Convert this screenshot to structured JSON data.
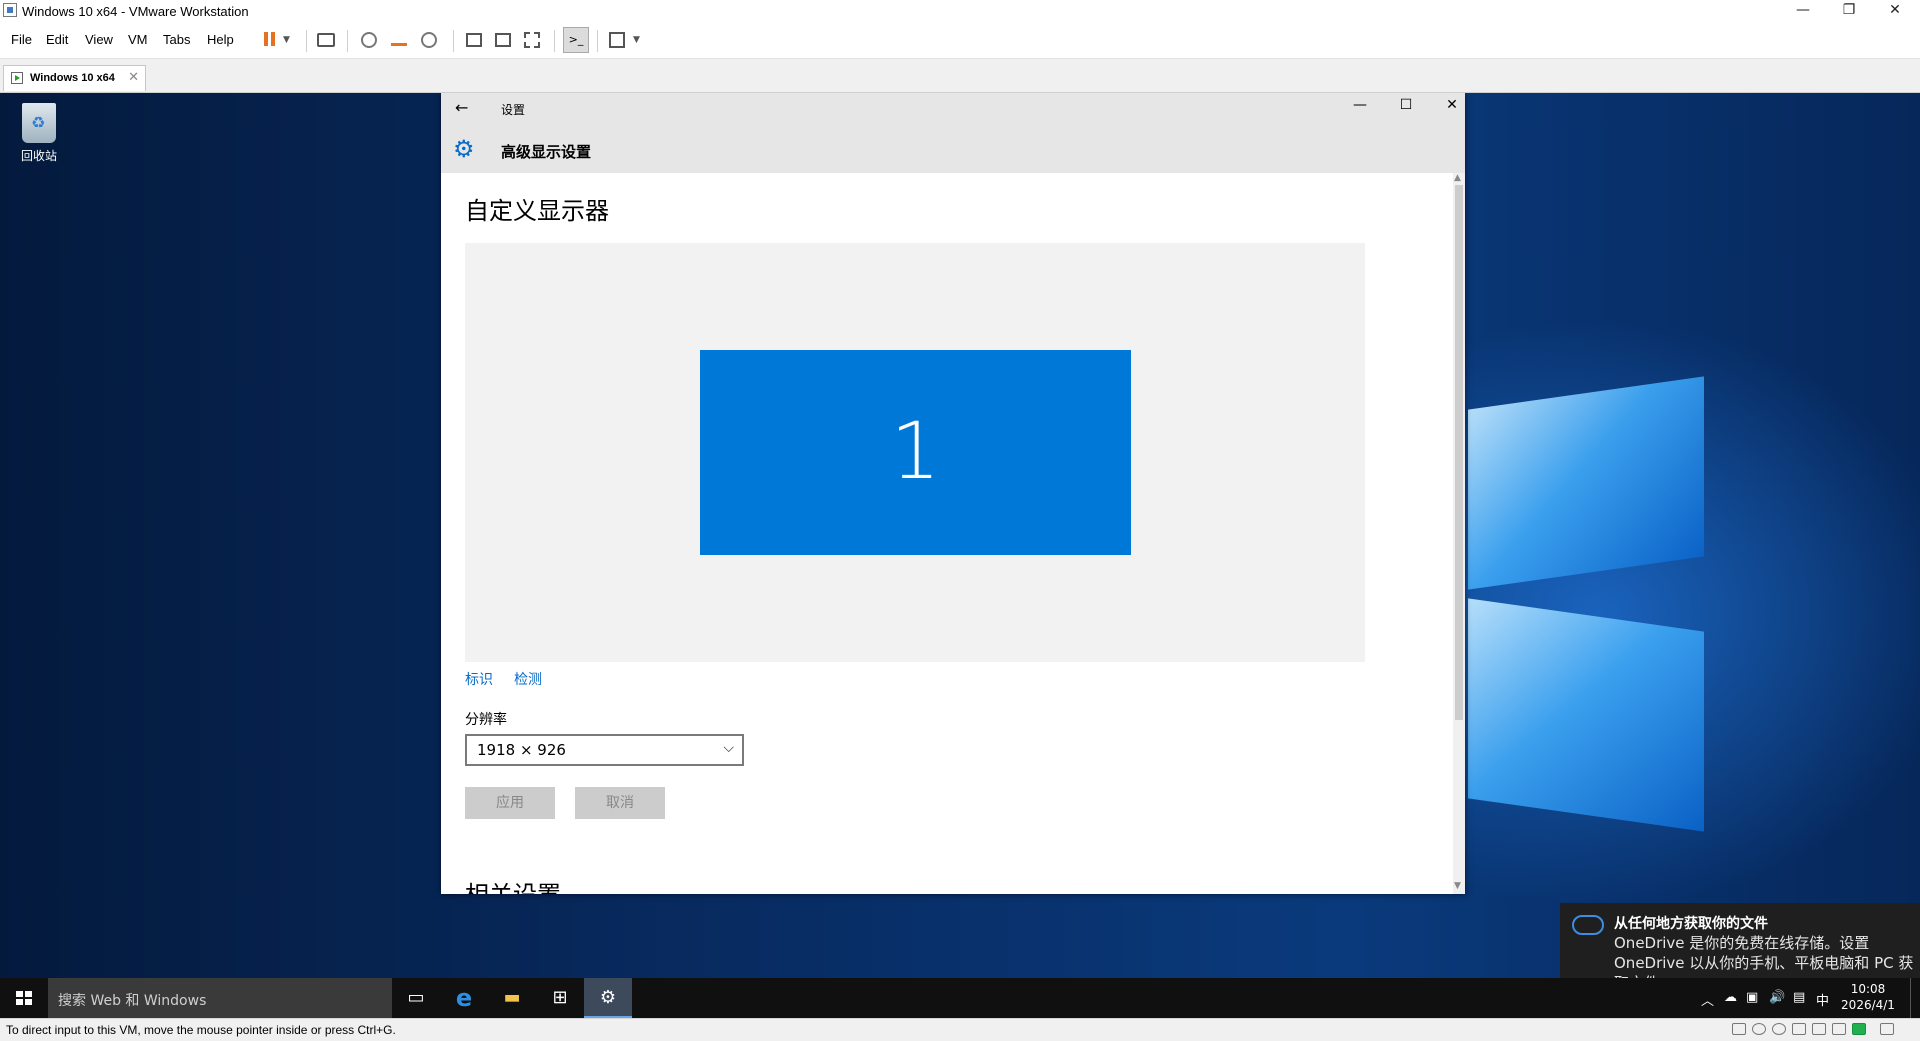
{
  "window": {
    "title": "Windows 10 x64 - VMware Workstation"
  },
  "menu": [
    "File",
    "Edit",
    "View",
    "VM",
    "Tabs",
    "Help"
  ],
  "vm_tab": {
    "label": "Windows 10 x64"
  },
  "desktop": {
    "recycle_bin_label": "回收站"
  },
  "settings": {
    "app_name": "设置",
    "page_title": "高级显示设置",
    "section_title": "自定义显示器",
    "monitor_number": "1",
    "link_identify": "标识",
    "link_detect": "检测",
    "resolution_label": "分辨率",
    "resolution_value": "1918 × 926",
    "apply_label": "应用",
    "cancel_label": "取消",
    "related_title": "相关设置"
  },
  "toast": {
    "title": "从任何地方获取你的文件",
    "body": "OneDrive 是你的免费在线存储。设置 OneDrive 以从你的手机、平板电脑和 PC 获取文件"
  },
  "taskbar": {
    "search_placeholder": "搜索 Web 和 Windows",
    "ime": "中",
    "time": "10:08",
    "date": "2026/4/1"
  },
  "statusbar": {
    "message": "To direct input to this VM, move the mouse pointer inside or press Ctrl+G."
  },
  "colors": {
    "accent": "#0078d7",
    "taskbar": "#101010",
    "pause": "#e8711f"
  }
}
